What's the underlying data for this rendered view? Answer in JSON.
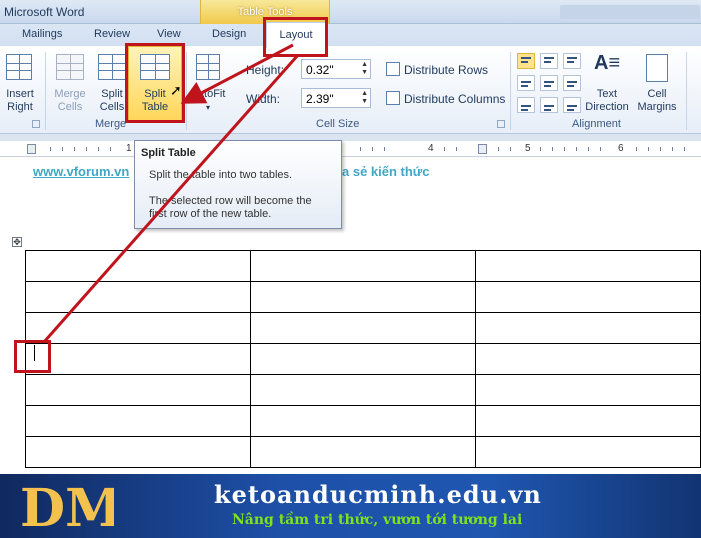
{
  "window": {
    "title": "Microsoft Word"
  },
  "context_tab": {
    "label": "Table Tools"
  },
  "tabs": [
    {
      "id": "mailings",
      "label": "Mailings"
    },
    {
      "id": "review",
      "label": "Review"
    },
    {
      "id": "view",
      "label": "View"
    },
    {
      "id": "design",
      "label": "Design"
    },
    {
      "id": "layout",
      "label": "Layout"
    }
  ],
  "ribbon": {
    "insert_right": {
      "line1": "Insert",
      "line2": "Right"
    },
    "merge_group": {
      "label": "Merge",
      "merge_cells": {
        "line1": "Merge",
        "line2": "Cells"
      },
      "split_cells": {
        "line1": "Split",
        "line2": "Cells"
      },
      "split_table": {
        "line1": "Split",
        "line2": "Table"
      }
    },
    "autofit": {
      "label": "AutoFit"
    },
    "cell_size_group": {
      "label": "Cell Size",
      "height_label": "Height:",
      "height_value": "0.32\"",
      "width_label": "Width:",
      "width_value": "2.39\"",
      "distribute_rows": "Distribute Rows",
      "distribute_columns": "Distribute Columns"
    },
    "alignment_group": {
      "label": "Alignment",
      "text_direction": {
        "line1": "Text",
        "line2": "Direction"
      },
      "cell_margins": {
        "line1": "Cell",
        "line2": "Margins"
      }
    }
  },
  "ruler": {
    "numbers": [
      "1",
      "4",
      "5",
      "6"
    ]
  },
  "tooltip": {
    "title": "Split Table",
    "line1": "Split the table into two tables.",
    "line2": "The selected row will become the",
    "line3": "first row of the new table."
  },
  "document": {
    "link_text": "www.vforum.vn",
    "trailing_text": "a sẻ kiến thức",
    "table": {
      "rows": 7,
      "cols": 3
    }
  },
  "banner": {
    "site": "ketoanducminh.edu.vn",
    "slogan": "Nâng tầm tri thức, vươn tới tương lai",
    "logo_text": "DM"
  },
  "colors": {
    "annotation_red": "#c0141c",
    "link": "#41a7c4",
    "banner_blue": "#1e50a8",
    "slogan_green": "#7de31a",
    "highlight_gold": "#ffd659"
  },
  "icons": {
    "split_table": "table-split-icon",
    "merge_cells": "merge-cells-icon",
    "split_cells": "split-cells-icon",
    "insert_right": "insert-right-icon",
    "autofit": "autofit-icon",
    "text_direction": "text-direction-icon",
    "cell_margins": "cell-margins-icon",
    "table_move_handle": "move-handle-icon"
  }
}
